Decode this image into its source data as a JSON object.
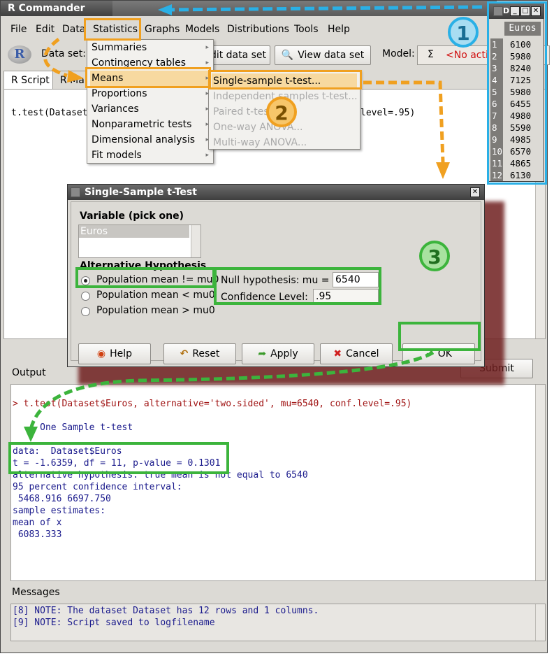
{
  "main_window": {
    "title": "R Commander",
    "menus": [
      "File",
      "Edit",
      "Data",
      "Statistics",
      "Graphs",
      "Models",
      "Distributions",
      "Tools",
      "Help"
    ]
  },
  "toolbar": {
    "dataset_label": "Data set:",
    "edit_button": "dit data set",
    "view_button": "View data set",
    "model_label": "Model:",
    "model_sigma": "Σ",
    "model_value": "<No activ"
  },
  "tabs": [
    "R Script",
    "R Mar"
  ],
  "script": {
    "line_start": "t.test(Dataset",
    "line_end": "level=.95)"
  },
  "statistics_menu": {
    "items": [
      "Summaries",
      "Contingency tables",
      "Means",
      "Proportions",
      "Variances",
      "Nonparametric tests",
      "Dimensional analysis",
      "Fit models"
    ]
  },
  "means_submenu": {
    "items": [
      "Single-sample t-test...",
      "Independent samples t-test...",
      "Paired t-test...",
      "One-way ANOVA...",
      "Multi-way ANOVA..."
    ]
  },
  "data_window": {
    "title": "D",
    "column": "Euros",
    "rows": [
      {
        "idx": "1",
        "val": "6100"
      },
      {
        "idx": "2",
        "val": "5980"
      },
      {
        "idx": "3",
        "val": "8240"
      },
      {
        "idx": "4",
        "val": "7125"
      },
      {
        "idx": "5",
        "val": "5980"
      },
      {
        "idx": "6",
        "val": "6455"
      },
      {
        "idx": "7",
        "val": "4980"
      },
      {
        "idx": "8",
        "val": "5590"
      },
      {
        "idx": "9",
        "val": "4985"
      },
      {
        "idx": "10",
        "val": "6570"
      },
      {
        "idx": "11",
        "val": "4865"
      },
      {
        "idx": "12",
        "val": "6130"
      }
    ]
  },
  "dialog": {
    "title": "Single-Sample t-Test",
    "variable_heading": "Variable (pick one)",
    "variable_option": "Euros",
    "alt_heading": "Alternative Hypothesis",
    "radios": [
      "Population mean != mu0",
      "Population mean < mu0",
      "Population mean > mu0"
    ],
    "null_label": "Null hypothesis: mu =",
    "null_value": "6540",
    "conf_label": "Confidence Level:",
    "conf_value": ".95",
    "buttons": {
      "help": "Help",
      "reset": "Reset",
      "apply": "Apply",
      "cancel": "Cancel",
      "ok": "OK"
    }
  },
  "submit_button": "Submit",
  "output": {
    "label": "Output",
    "command": "> t.test(Dataset$Euros, alternative='two.sided', mu=6540, conf.level=.95)",
    "lines": [
      "     One Sample t-test",
      "",
      "data:  Dataset$Euros",
      "t = -1.6359, df = 11, p-value = 0.1301",
      "alternative hypothesis: true mean is not equal to 6540",
      "95 percent confidence interval:",
      " 5468.916 6697.750",
      "sample estimates:",
      "mean of x",
      " 6083.333"
    ]
  },
  "messages": {
    "label": "Messages",
    "lines": [
      "[8] NOTE: The dataset Dataset has 12 rows and 1 columns.",
      "[9] NOTE: Script saved to logfilename"
    ]
  },
  "badges": [
    "1",
    "2",
    "3"
  ],
  "colors": {
    "highlight_orange": "#f0a020",
    "highlight_green": "#3cb43c",
    "highlight_blue": "#2ab0e6",
    "command_red": "#a01414",
    "output_blue": "#1a1a8c"
  }
}
